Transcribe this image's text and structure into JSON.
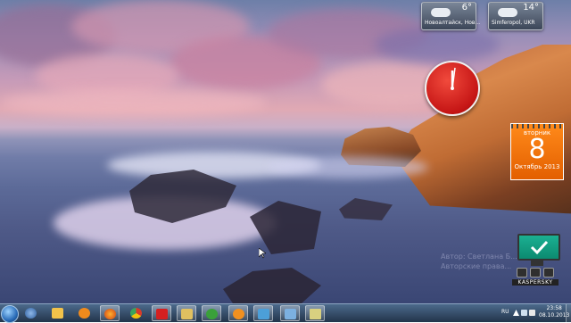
{
  "gadgets": {
    "weather_left": {
      "temp": "6°",
      "location": "Новоалтайск, Нов..."
    },
    "weather_right": {
      "temp": "14°",
      "location": "Simferopol, UKR"
    },
    "calendar": {
      "weekday": "вторник",
      "day": "8",
      "month_year": "Октябрь 2013"
    },
    "kaspersky": {
      "label": "KASPERSKY"
    }
  },
  "watermark": {
    "line1": "Автор: Светлана Б...",
    "line2": "Авторские права..."
  },
  "taskbar": {
    "pinned": [
      {
        "name": "windows-explorer",
        "color": "#f2c24a"
      },
      {
        "name": "media-player",
        "color": "#f08a1c"
      },
      {
        "name": "firefox",
        "color": "#e8671a"
      },
      {
        "name": "chrome",
        "color": "#3b9b3b"
      },
      {
        "name": "kaspersky-app",
        "color": "#d42020"
      },
      {
        "name": "folder",
        "color": "#e0c060"
      },
      {
        "name": "utorrent",
        "color": "#3aa03a"
      },
      {
        "name": "orange-app",
        "color": "#f09020"
      },
      {
        "name": "screen-app",
        "color": "#4c9fd8"
      },
      {
        "name": "paint",
        "color": "#7cb0e0"
      },
      {
        "name": "notes",
        "color": "#d8d080"
      }
    ],
    "language": "RU",
    "time": "23:58",
    "date": "08.10.2013"
  }
}
